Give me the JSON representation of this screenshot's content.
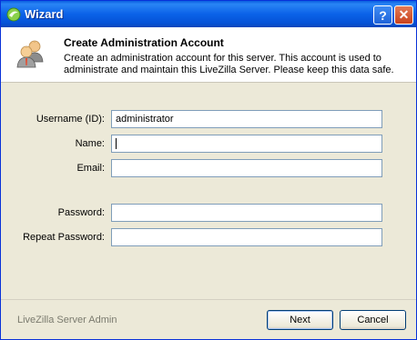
{
  "window": {
    "title": "Wizard",
    "help_glyph": "?",
    "close_glyph": "✕",
    "icon": "livezilla-icon"
  },
  "header": {
    "title": "Create Administration Account",
    "description": "Create an administration account for this server. This account is used to administrate and maintain this LiveZilla Server. Please keep this data safe.",
    "icon": "admin-users-icon"
  },
  "form": {
    "username": {
      "label": "Username (ID):",
      "value": "administrator"
    },
    "name": {
      "label": "Name:",
      "value": ""
    },
    "email": {
      "label": "Email:",
      "value": ""
    },
    "password": {
      "label": "Password:",
      "value": ""
    },
    "repeat_password": {
      "label": "Repeat Password:",
      "value": ""
    }
  },
  "footer": {
    "app_label": "LiveZilla Server Admin",
    "next_label": "Next",
    "cancel_label": "Cancel"
  },
  "colors": {
    "titlebar": "#0b62e8",
    "close_button": "#c9421c",
    "dialog_bg": "#ece9d8",
    "input_border": "#7f9db9"
  }
}
